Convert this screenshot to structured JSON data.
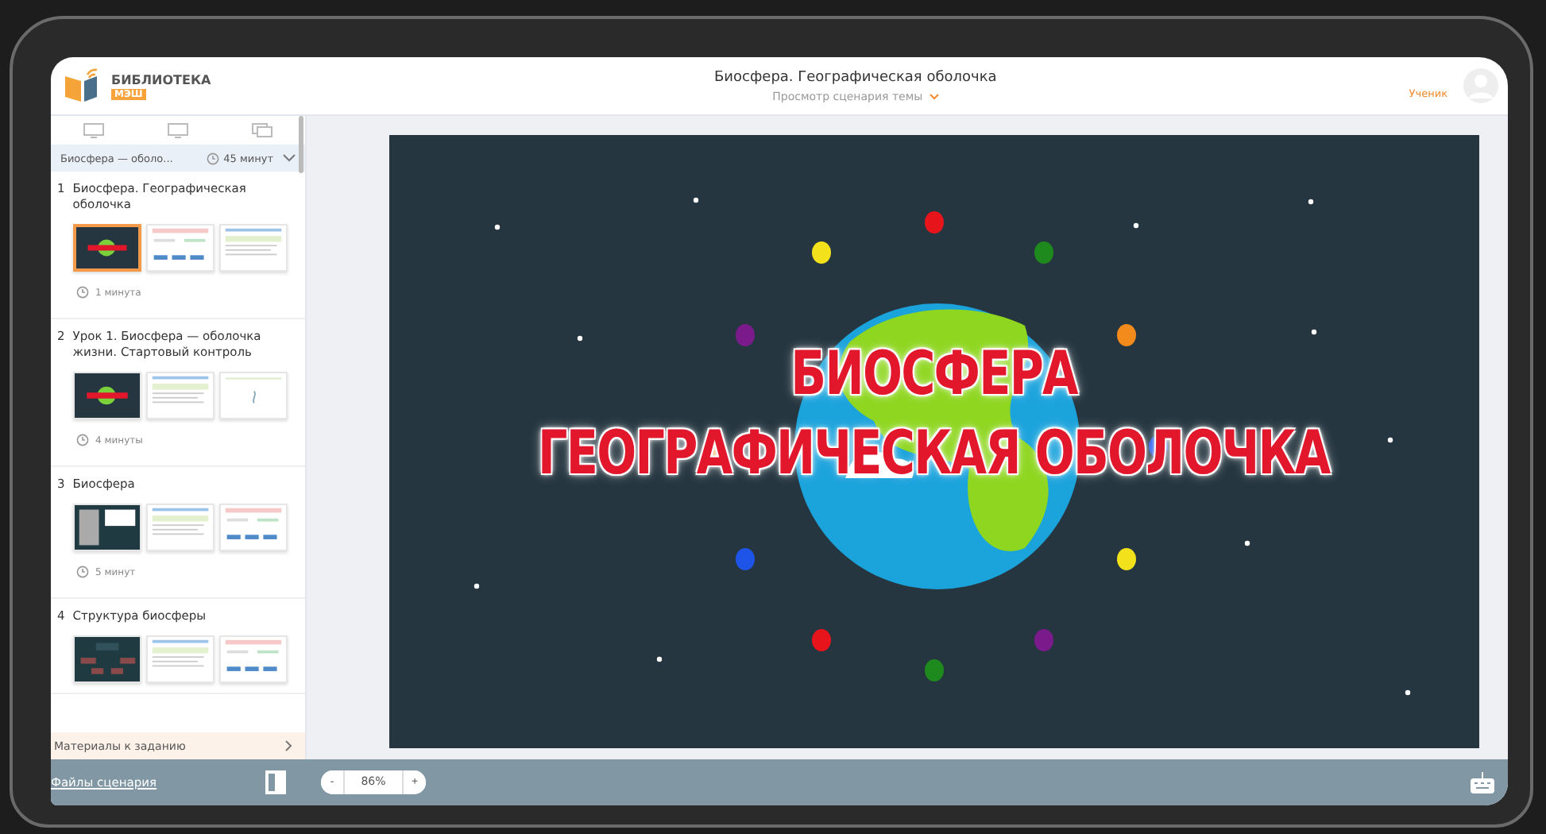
{
  "header": {
    "logo_text": "БИБЛИОТЕКА",
    "logo_badge": "МЭШ",
    "title": "Биосфера. Географическая оболочка",
    "subtitle": "Просмотр сценария темы",
    "role": "Ученик"
  },
  "sidebar": {
    "view_tabs": [
      {
        "selected": false
      },
      {
        "selected": false
      },
      {
        "selected": false
      }
    ],
    "topic": "Биосфера — оболо...",
    "duration": "45 минут",
    "stages": [
      {
        "number": "1",
        "title": "Биосфера. Географическая оболочка",
        "duration": "1 минута",
        "thumbs": [
          {
            "kind": "title",
            "selected": true
          },
          {
            "kind": "test",
            "selected": false
          },
          {
            "kind": "text",
            "selected": false
          }
        ]
      },
      {
        "number": "2",
        "title": "Урок 1. Биосфера — оболочка жизни. Стартовый контроль",
        "duration": "4 минуты",
        "thumbs": [
          {
            "kind": "title",
            "selected": false
          },
          {
            "kind": "text",
            "selected": false
          },
          {
            "kind": "blank",
            "selected": false
          }
        ]
      },
      {
        "number": "3",
        "title": "Биосфера",
        "duration": "5 минут",
        "thumbs": [
          {
            "kind": "photo",
            "selected": false
          },
          {
            "kind": "text",
            "selected": false
          },
          {
            "kind": "test",
            "selected": false
          }
        ]
      },
      {
        "number": "4",
        "title": "Структура биосферы",
        "thumbs": [
          {
            "kind": "scheme",
            "selected": false
          },
          {
            "kind": "text",
            "selected": false
          },
          {
            "kind": "test",
            "selected": false
          }
        ]
      }
    ],
    "materials": "Материалы к заданию"
  },
  "slide": {
    "title_lines": [
      "БИОСФЕРА",
      "ГЕОГРАФИЧЕСКАЯ ОБОЛОЧКА"
    ]
  },
  "footer": {
    "files_link": "Файлы сценария",
    "zoom_minus": "-",
    "zoom": "86%",
    "zoom_plus": "+"
  }
}
